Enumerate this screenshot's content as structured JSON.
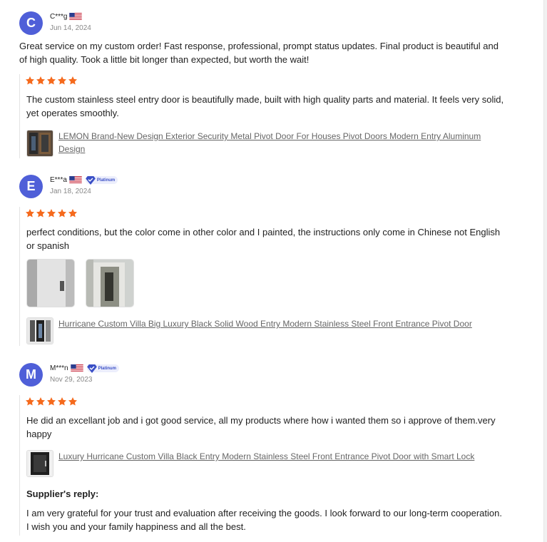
{
  "colors": {
    "accent": "#4f5fd8",
    "star": "#f56a1d",
    "platinum": "#3a4fc6"
  },
  "reviews": [
    {
      "avatar_letter": "C",
      "name": "C***g",
      "flag": "us-flag-icon",
      "platinum": "",
      "date": "Jun 14, 2024",
      "intro": "Great service on my custom order! Fast response, professional, prompt status updates. Final product is beautiful and of high quality. Took a little bit longer than expected, but worth the wait!",
      "rating": 5,
      "text": "The custom stainless steel entry door is beautifully made, built with high quality parts and material. It feels very solid, yet operates smoothly.",
      "product": "LEMON Brand-New Design Exterior Security Metal Pivot Door For Houses Pivot Doors Modern Entry Aluminum Design"
    },
    {
      "avatar_letter": "E",
      "name": "E***a",
      "flag": "us-flag-icon",
      "platinum": "Platinum",
      "date": "Jan 18, 2024",
      "rating": 5,
      "text": "perfect conditions, but the color come in other color and I painted, the instructions only come in Chinese not English or spanish",
      "photo_count": 2,
      "product": "Hurricane Custom Villa Big Luxury Black Solid Wood Entry Modern Stainless Steel Front Entrance Pivot Door"
    },
    {
      "avatar_letter": "M",
      "name": "M***n",
      "flag": "us-flag-icon",
      "platinum": "Platinum",
      "date": "Nov 29, 2023",
      "rating": 5,
      "text": "He did an excellant job and i got good service, all my products where how i wanted them so i approve of them.very happy",
      "product": "Luxury Hurricane Custom Villa Black Entry Modern Stainless Steel Front Entrance Pivot Door with Smart Lock",
      "reply_title": "Supplier's reply:",
      "reply_text": "I am very grateful for your trust and evaluation after receiving the goods. I look forward to our long-term cooperation. I wish you and your family happiness and all the best."
    }
  ]
}
